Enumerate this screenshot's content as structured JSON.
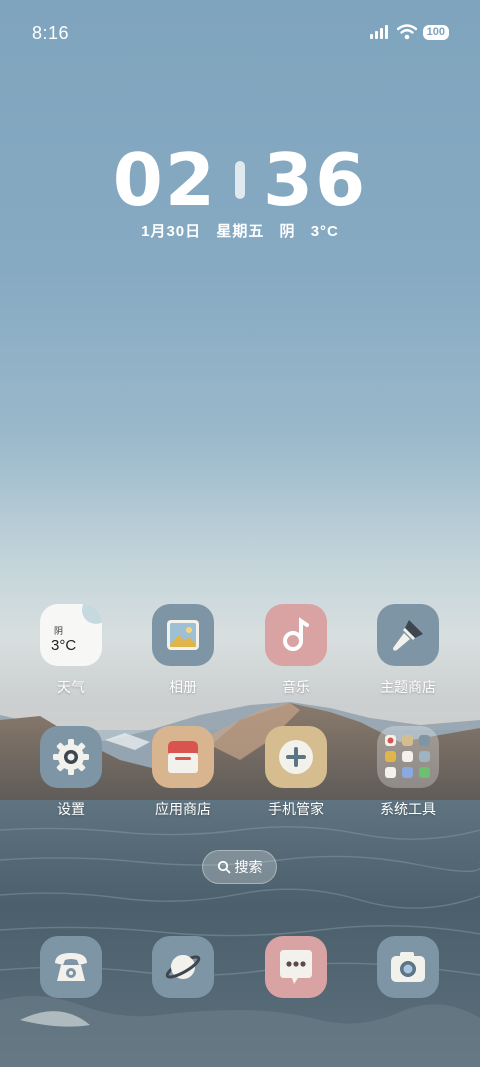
{
  "status_bar": {
    "time": "8:16",
    "battery": "100"
  },
  "clock": {
    "hours": "02",
    "minutes": "36",
    "date": "1月30日",
    "weekday": "星期五",
    "weather": "阴",
    "temp": "3°C"
  },
  "weather_widget": {
    "condition": "阴",
    "temp": "3°C"
  },
  "apps": [
    {
      "label": "天气"
    },
    {
      "label": "相册"
    },
    {
      "label": "音乐"
    },
    {
      "label": "主题商店"
    },
    {
      "label": "设置"
    },
    {
      "label": "应用商店"
    },
    {
      "label": "手机管家"
    },
    {
      "label": "系统工具"
    }
  ],
  "search": {
    "label": "搜索"
  },
  "colors": {
    "accent_music": "#d9a3a3",
    "accent_store": "#d8b58e",
    "accent_manager": "#d6bd8f",
    "icon_slate": "#7e95a6"
  }
}
